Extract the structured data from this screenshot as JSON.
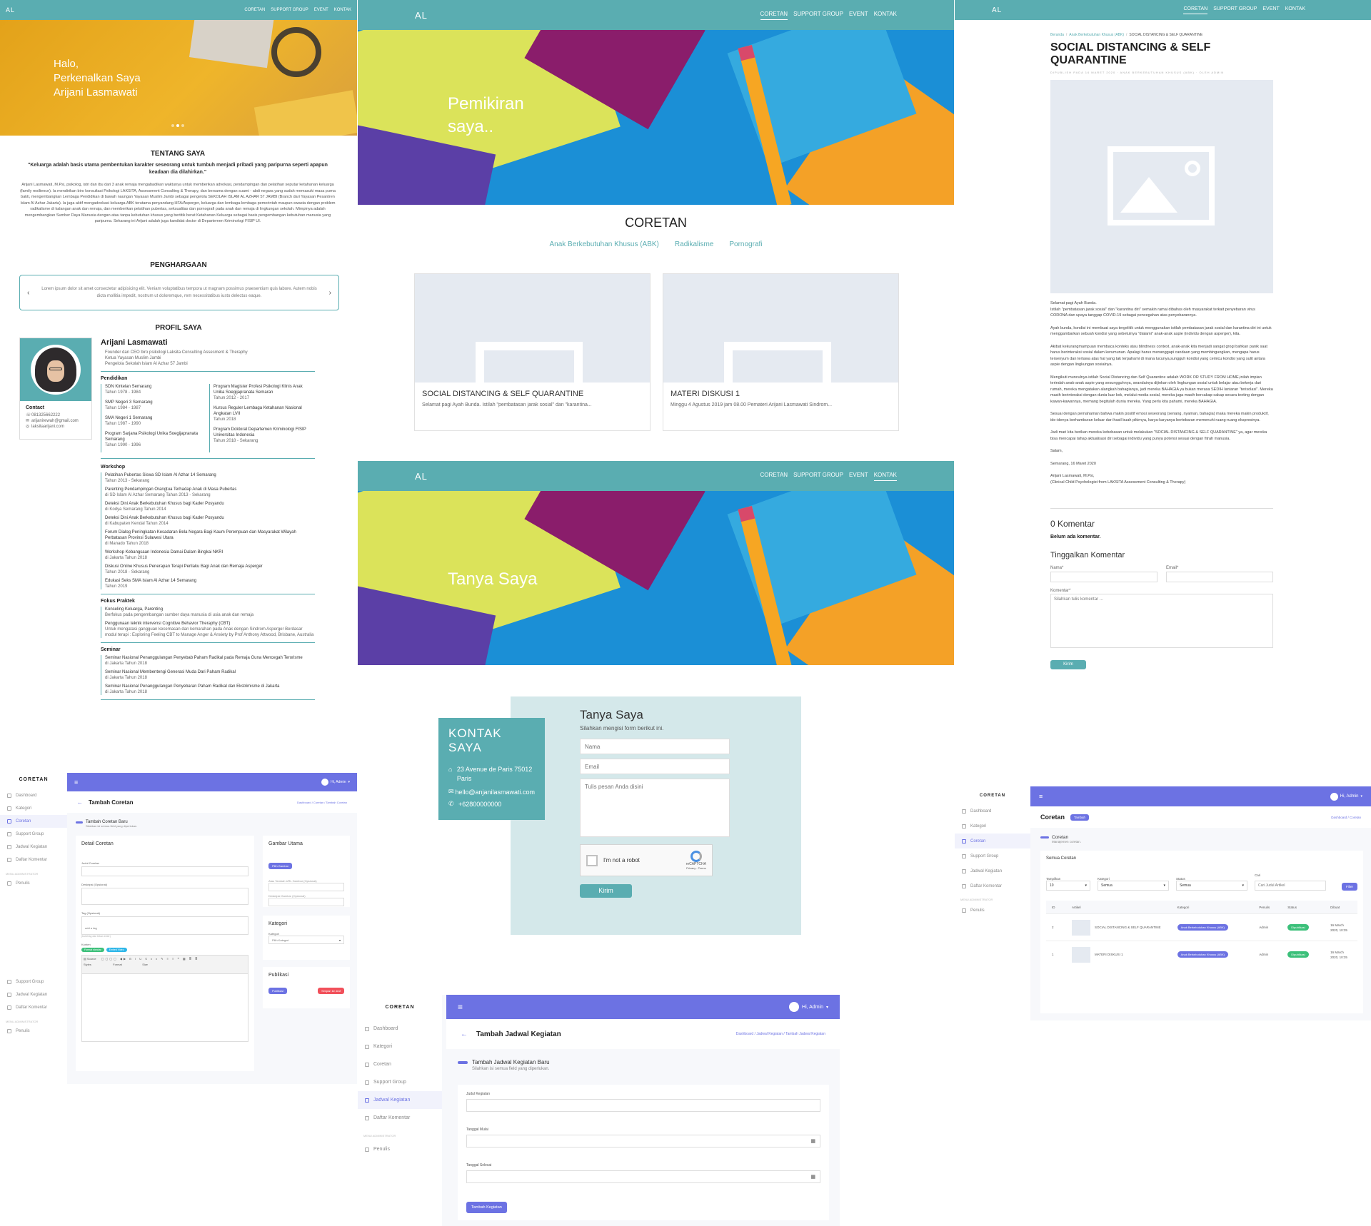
{
  "site": {
    "logo": "AL",
    "nav": [
      "CORETAN",
      "SUPPORT GROUP",
      "EVENT",
      "KONTAK"
    ]
  },
  "profile": {
    "hero_lines": [
      "Halo,",
      "Perkenalkan Saya",
      "Arijani Lasmawati"
    ],
    "about_title": "TENTANG SAYA",
    "quote": "\"Keluarga adalah basis utama pembentukan karakter seseorang untuk tumbuh menjadi pribadi yang paripurna seperti apapun keadaan dia dilahirkan.\"",
    "about_text": "Arijani Lasmawati, M.Psi, psikolog, istri dan ibu dari 3 anak remaja mengabadikan waktunya untuk memberikan advokasi, pendampingan dan pelatihan seputar ketahanan keluarga (family resilience). Ia mendirikan biro konsultasi Psikologi LAKSITA, Assessment Consulting & Therapy, dan bersama dengan suami - abdi negara yang sudah memasuki masa purna bakti, mengembangkan Lembaga Pendidikan di bawah naungan Yayasan Muslim Jambi sebagai pengelola SEKOLAH ISLAM AL AZHAR 57 JAMBI (Branch dari Yayasan Pesantren Islam Al Azhar Jakarta). Ia juga aktif mengadvokasi keluarga ABK terutama penyandang HFA/Asperger, keluarga dan lembaga-lembaga pemerintah maupun swasta dengan problem radikalisme di kalangan anak dan remaja, dan memberikan pelatihan pubertas, seksualitas dan pornografi pada anak dan remaja di lingkungan sekolah. Mimpinya adalah mengembangkan Sumber Daya Manusia dengan atau tanpa kebutuhan khusus yang bertitik berat Ketahanan Keluarga sebagai basis pengembangan kebutuhan manusia yang paripurna. Sekarang ini Arijani adalah juga kandidat doctor di Departemen Kriminologi FISIP UI.",
    "awards_title": "PENGHARGAAN",
    "award_text": "Lorem ipsum dolor sit amet consectetur adipisicing elit. Veniam voluptatibus tempora ut magnam possimus praesentium quis labore. Autem nobis dicta mollitia impedit, nostrum ut doloremque, rem necessitatibus iusto delectus eaque.",
    "profile_title": "PROFIL SAYA",
    "name": "Arijani Lasmawati",
    "roles": [
      "Founder dan CEO biro psikologi Laksita Consulting Assesment & Theraphy",
      "Ketua Yayasan Muslim Jambi",
      "Pengelola Sekolah Islam Al Azhar 57 Jambi"
    ],
    "contact_title": "Contact",
    "contacts": [
      "081325662222",
      "arijanirewah@gmail.com",
      "laksitaarijani.com"
    ],
    "edu_title": "Pendidikan",
    "edu_left": [
      {
        "t": "SDN Kintelan Semarang",
        "y": "Tahun 1978 - 1984"
      },
      {
        "t": "SMP Negeri 3 Semarang",
        "y": "Tahun 1984 - 1987"
      },
      {
        "t": "SMA Negeri 1 Semarang",
        "y": "Tahun 1987 - 1990"
      },
      {
        "t": "Program Sarjana Psikologi Unika Soegijapranata Semarang",
        "y": "Tahun 1990 - 1996"
      }
    ],
    "edu_right": [
      {
        "t": "Program Magister Profesi Psikologi Klinis Anak Unika Soegijapranata Semaran",
        "y": "Tahun 2012 - 2017"
      },
      {
        "t": "Kursus Reguler Lembaga Ketahanan Nasional Angkatan LVII",
        "y": "Tahun 2018"
      },
      {
        "t": "Program Doktoral Departemen Kriminologi FISIP Universitas Indonesia",
        "y": "Tahun 2018 - Sekarang"
      }
    ],
    "workshop_title": "Workshop",
    "workshops": [
      {
        "t": "Pelatihan Pubertas Siswa SD Islam Al Azhar 14 Semarang",
        "y": "Tahun 2013 - Sekarang"
      },
      {
        "t": "Parenting Pendampingan Orangtua Terhadap Anak di Masa Pubertas",
        "y": "di SD Islam Al Azhar Semarang Tahun 2013 - Sekarang"
      },
      {
        "t": "Deteksi Dini Anak Berkebutuhan Khusus bagi Kader Posyandu",
        "y": "di Kodya Semarang Tahun 2014"
      },
      {
        "t": "Deteksi Dini Anak Berkebutuhan Khusus bagi Kader Posyandu",
        "y": "di Kabupaten Kendal Tahun 2014"
      },
      {
        "t": "Forum Dialog Peningkatan Kesadaran Bela Negara Bagi Kaum Perempuan dan Masyarakat Wilayah Perbatasan Provinsi Sulawesi Utara",
        "y": "di Manado Tahun 2018"
      },
      {
        "t": "Workshop Kebangsaan Indonesia Damai Dalam Bingkai NKRI",
        "y": "di Jakarta Tahun 2018"
      },
      {
        "t": "Diskusi Online Khusus Penerapan Terapi Perilaku Bagi Anak dan Remaja Asperger",
        "y": "Tahun 2018 - Sekarang"
      },
      {
        "t": "Edukasi Seks SMA Islam Al Azhar 14 Semarang",
        "y": "Tahun 2019"
      }
    ],
    "fokus_title": "Fokus Praktek",
    "fokus": [
      {
        "t": "Konseling Keluarga, Parenting",
        "y": "Berfokus pada pengembangan sumber daya manusia di usia anak dan remaja"
      },
      {
        "t": "Penggunaan teknik intervensi Cognitive Behavior Theraphy (CBT)",
        "y": "Untuk mengatasi gangguan kecemasan dan kemarahan pada Anak dengan Sindrom Asperger Berdasar modul terapi : Exploring Feeling CBT to Manage Anger & Anxiety by Prof Anthony Attwood, Brisbane, Australia"
      }
    ],
    "seminar_title": "Seminar",
    "seminars": [
      {
        "t": "Seminar Nasional Penanggulangan Penyebab Paham Radikal pada Remaja Guna Mencegah Terorisme",
        "y": "di Jakarta Tahun 2018"
      },
      {
        "t": "Seminar Nasional Membentengi Generasi Muda Dari Paham Radikal",
        "y": "di Jakarta Tahun 2018"
      },
      {
        "t": "Seminar Nasional Penanggulangan Penyebaran Paham Radikal dan Ekstrimisme di Jakarta",
        "y": "di Jakarta Tahun 2018"
      }
    ]
  },
  "coretan": {
    "hero_lines": [
      "Pemikiran",
      "saya.."
    ],
    "title": "CORETAN",
    "categories": [
      "Anak Berkebutuhan Khusus (ABK)",
      "Radikalisme",
      "Pornografi"
    ],
    "cards": [
      {
        "title": "SOCIAL DISTANCING & SELF QUARANTINE",
        "excerpt": "Selamat pagi Ayah Bunda. Istilah \"pembatasan jarak sosial\" dan \"karantina..."
      },
      {
        "title": "MATERI DISKUSI 1",
        "excerpt": "Minggu 4 Agustus 2019 jam 08.00 Pemateri Arijani Lasmawati Sindrom..."
      }
    ]
  },
  "kontak": {
    "hero_title": "Tanya Saya",
    "box_title": "KONTAK SAYA",
    "address": "23 Avenue de Paris 75012 Paris",
    "email": "hello@anjanilasmawati.com",
    "phone": "+62800000000",
    "form_title": "Tanya Saya",
    "form_sub": "Silahkan mengisi form berikut ini.",
    "ph_name": "Nama",
    "ph_email": "Email",
    "ph_msg": "Tulis pesan Anda disini",
    "captcha": "I'm not a robot",
    "captcha_brand": "reCAPTCHA",
    "captcha_links": "Privacy - Terms",
    "submit": "Kirim"
  },
  "article": {
    "breadcrumb": [
      "Beranda",
      "Anak Berkebutuhan Khusus (ABK)",
      "SOCIAL DISTANCING & SELF QUARANTINE"
    ],
    "title": "SOCIAL DISTANCING & SELF QUARANTINE",
    "meta": "DIPUBLISH PADA 16 MARET 2020 · ANAK BERKEBUTUHAN KHUSUS (ABK) · OLEH ADMIN",
    "paragraphs": [
      "Selamat pagi Ayah Bunda.",
      "Istilah \"pembatasan jarak sosial\" dan \"karantina diri\" semakin ramai dibahas oleh masyarakat terkait penyebaran virus CORONA dan upaya tanggap COVID-19 sebagai pencegahan atas penyebarannya.",
      "Ayah bunda, kondisi ini membuat saya tergelitik untuk menggunakan istilah pembatasan jarak sosial dan karantina diri ini untuk menggambarkan sebuah kondisi yang sebetulnya \"dialami\" anak-anak aspie (individu dengan asperger), kita.",
      "Akibat kekurangmampuan membaca konteks atau blindness context, anak-anak kita menjadi sangat grogi bahkan panik saat harus berinteraksi sosial dalam kerumunan. Apalagi harus menanggapi candaan yang membingungkan, mengapa harus tersenyum dan tertawa atas hal yang tak terpahami di mana lucunya,sungguh kondisi yang cemicu kondisi yang sulit antara aspie dengan lingkungan sosialnya.",
      "Mengikuti munculnya istilah Social Distancing dan Self Quarantine adalah WORK OR STUDY FROM HOME,inilah impian terindah anak-anak aspie yang sesungguhnya, seandainya dijinkan oleh lingkungan sosial untuk belajar atau bekerja dari rumah, mereka mengatakan alangkah bahagianya, jadi mereka BAHAGIA ya bukan merasa SEDIH lantaran \"terisolasi\". Mereka masih berinteraksi dengan dunia luar kok, melalui media sosial, mereka juga masih bercakap-cakap secara teeting dengan kawan-kawannya, memang begitulah dunia mereka. Yang perlu kita pahami, mereka BAHAGIA.",
      "Sesuai dengan pemahaman bahwa makin positif emosi seseorang (senang, nyaman, bahagia) maka mereka makin produktif, ide-idenya berhamburan keluar dari hasil buah pikirnya, karya-karyanya bertebaran memenuhi ruang-ruang ekspresinya.",
      "Jadi mari kita berikan mereka kebebasan untuk melakukan \"SOCIAL DISTANCING & SELF QUARANTINE\" ya, agar mereka bisa mencapai tahap aktualisasi diri sebagai individu yang punya potensi sesuai dengan fitrah manusia.",
      "Salam,",
      "Semarang, 16 Maret 2020",
      "Arijani Lasmawati, M.Psi,\n(Clinical Child Psychologist from LAKSITA Assessment Consulting & Therapy)"
    ],
    "comments_count": "0 Komentar",
    "no_comments": "Belum ada komentar.",
    "leave_title": "Tinggalkan Komentar",
    "lbl_name": "Nama*",
    "lbl_email": "Email*",
    "lbl_comment": "Komentar*",
    "ph_comment": "Silahkan tulis komentar ...",
    "submit": "Kirim"
  },
  "admin": {
    "user": "Hi, Admin",
    "brand": "CORETAN",
    "menu": [
      "Dashboard",
      "Kategori",
      "Coretan",
      "Support Group",
      "Jadwal Kegiatan",
      "Daftar Komentar"
    ],
    "menu_admin_label": "MENU ADMINISTRATOR",
    "menu_admin": [
      "Penulis"
    ],
    "add_coretan": {
      "title": "Tambah Coretan",
      "crumbs": "Dashboard / Coretan / Tambah Coretan",
      "section": "Tambah Coretan Baru",
      "section_sub": "Silahkan isi semua field yang diperlukan.",
      "detail_title": "Detail Coretan",
      "lbl_title": "Judul Coretan",
      "lbl_desc": "Deskripsi (Opsional)",
      "lbl_tag": "Tag (Opsional)",
      "tag_ph": "add a tag",
      "tag_hint": "(build tag dan tekan enter)",
      "lbl_content": "Konten",
      "btn_format": "Format standar",
      "btn_embed": "Embed Video",
      "editor_source": "Source",
      "editor_styles": "Styles",
      "editor_format": "Format",
      "editor_size": "Size",
      "image_title": "Gambar Utama",
      "btn_pick": "Pilih Gambar",
      "lbl_url": "Atau Tambah URL Gambar (Opsional)",
      "lbl_imgdesc": "Deskripsi Gambar (Opsional)",
      "cat_title": "Kategori",
      "lbl_cat": "Kategori",
      "cat_ph": "Pilih Kategori",
      "pub_title": "Publikasi",
      "btn_pub": "Publikasi",
      "btn_draft": "Simpan ke draf"
    },
    "jadwal": {
      "title": "Tambah Jadwal Kegiatan",
      "crumbs": "Dashboard / Jadwal Kegiatan / Tambah Jadwal Kegiatan",
      "section": "Tambah Jadwal Kegiatan Baru",
      "section_sub": "Silahkan isi semua field yang diperlukan.",
      "lbl_title": "Judul Kegiatan",
      "lbl_start": "Tanggal Mulai",
      "lbl_end": "Tanggal Selesai",
      "submit": "Tambah Kegiatan"
    },
    "list": {
      "title": "Coretan",
      "btn_add": "Tambah",
      "crumbs": "Dashboard / Coretan",
      "section": "Coretan",
      "section_sub": "Manajemen coretan.",
      "all": "Semua Coretan",
      "lbl_show": "Tampilkan",
      "show_val": "10",
      "lbl_cat": "Kategori",
      "cat_val": "Semua",
      "lbl_status": "Status",
      "status_val": "Semua",
      "lbl_search": "Cari",
      "search_ph": "Cari Judul Artikel",
      "btn_filter": "Filter",
      "columns": [
        "ID",
        "Artikel",
        "Kategori",
        "Penulis",
        "Status",
        "Dibuat"
      ],
      "rows": [
        {
          "id": "2",
          "title": "SOCIAL DISTANCING & SELF QUARANTINE",
          "cat": "Anak Berkebutuhan Khusus (ABK)",
          "author": "Admin",
          "status": "Dipublikasi",
          "date": "16 March 2020, 10:35"
        },
        {
          "id": "1",
          "title": "MATERI DISKUSI 1",
          "cat": "Anak Berkebutuhan Khusus (ABK)",
          "author": "Admin",
          "status": "Dipublikasi",
          "date": "16 March 2020, 10:35"
        }
      ]
    }
  }
}
